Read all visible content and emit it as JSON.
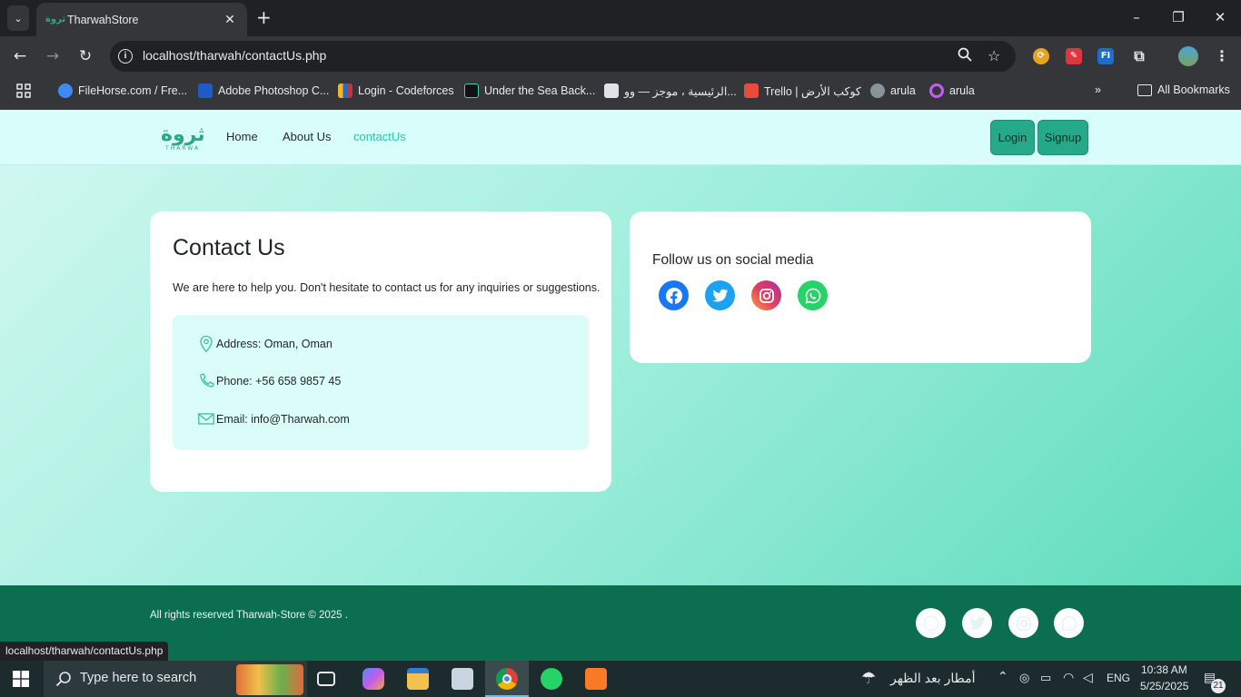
{
  "browser": {
    "tab_title": "TharwahStore",
    "tab_favicon": "ثروة",
    "url": "localhost/tharwah/contactUs.php",
    "bookmarks": [
      {
        "label": "FileHorse.com / Fre...",
        "color": "#3d8bf2"
      },
      {
        "label": "Adobe Photoshop C...",
        "color": "#1e5cc8"
      },
      {
        "label": "Login - Codeforces",
        "color": "#f2b62c"
      },
      {
        "label": "Under the Sea Back...",
        "color": "#111111"
      },
      {
        "label": "الرئيسية ، موجز — وو...",
        "color": "#dfe3e8"
      },
      {
        "label": "Trello | كوكب الأرض",
        "color": "#e84b3c"
      },
      {
        "label": "arula",
        "color": "#8a9399"
      },
      {
        "label": "arula",
        "color": "#c65cf2"
      }
    ],
    "all_bookmarks": "All Bookmarks",
    "status_url": "localhost/tharwah/contactUs.php"
  },
  "site": {
    "logo_ar": "ثروة",
    "logo_en": "THARWA",
    "nav": {
      "home": "Home",
      "about": "About Us",
      "contact": "contactUs"
    },
    "login": "Login",
    "signup": "Signup",
    "accent": "#25a988"
  },
  "contact": {
    "title": "Contact Us",
    "description": "We are here to help you. Don't hesitate to contact us for any inquiries or suggestions.",
    "address": "Address: Oman, Oman",
    "phone": "Phone: +56 658 9857 45",
    "email": "Email: info@Tharwah.com"
  },
  "social": {
    "title": "Follow us on social media",
    "icons": [
      "facebook-icon",
      "twitter-icon",
      "instagram-icon",
      "whatsapp-icon"
    ]
  },
  "footer": {
    "copyright": "All rights reserved Tharwah-Store © 2025 ."
  },
  "taskbar": {
    "search_placeholder": "Type here to search",
    "weather": "أمطار بعد الظهر",
    "language": "ENG",
    "time": "10:38 AM",
    "date": "5/25/2025",
    "notifications": "21"
  }
}
